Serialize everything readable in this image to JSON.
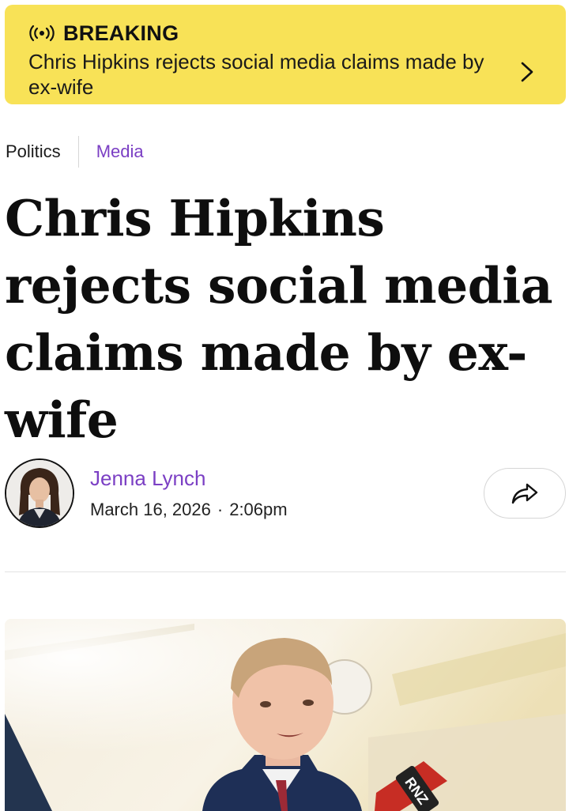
{
  "breaking": {
    "icon": "broadcast-icon",
    "tag": "BREAKING",
    "text": "Chris Hipkins rejects social media claims made by ex-wife",
    "accent_color": "#f8e257"
  },
  "tags": {
    "section": "Politics",
    "topic": "Media",
    "topic_color": "#7b3fc4"
  },
  "article": {
    "headline": "Chris Hipkins rejects social media claims made by ex-wife",
    "author": "Jenna Lynch",
    "date": "March 16, 2026",
    "separator": "·",
    "time": "2:06pm"
  },
  "hero": {
    "microphone_label": "RNZ"
  },
  "icons": {
    "chevron": "chevron-right-icon",
    "share": "share-icon"
  }
}
